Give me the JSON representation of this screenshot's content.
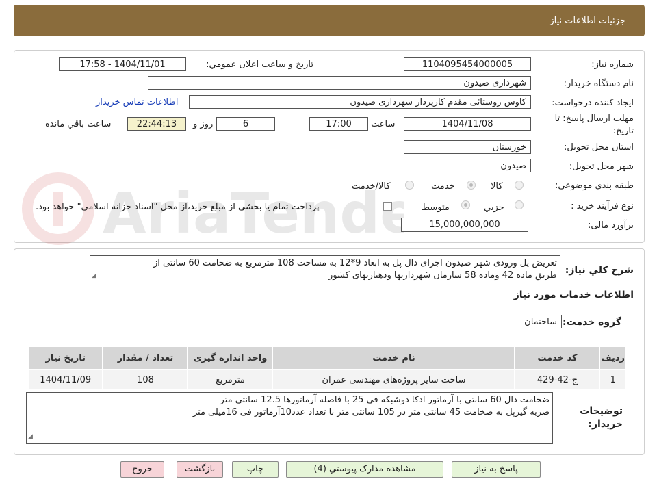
{
  "header": {
    "title": "جزئیات اطلاعات نیاز"
  },
  "form": {
    "need_number_label": "شماره نیاز:",
    "need_number": "1104095454000005",
    "announce_label": "تاریخ و ساعت اعلان عمومي:",
    "announce_value": "1404/11/01 - 17:58",
    "buyer_org_label": "نام دستگاه خريدار:",
    "buyer_org": "شهرداری صیدون",
    "creator_label": "ايجاد کننده درخواست:",
    "creator": "کاوس روستائی مقدم کارپرداز شهرداری صیدون",
    "contact_link": "اطلاعات تماس خريدار",
    "deadline_label": "مهلت ارسال پاسخ: تا",
    "deadline_label2": "تاریخ:",
    "deadline_date": "1404/11/08",
    "time_label": "ساعت",
    "deadline_time": "17:00",
    "days_value": "6",
    "days_label": "روز و",
    "remaining_time": "22:44:13",
    "remaining_label": "ساعت باقي مانده",
    "province_label": "استان محل تحويل:",
    "province": "خوزستان",
    "city_label": "شهر محل تحويل:",
    "city": "صیدون",
    "category_label": "طبقه بندی موضوعی:",
    "category_options": [
      "کالا",
      "خدمت",
      "کالا/خدمت"
    ],
    "category_selected": "خدمت",
    "process_label": "نوع فرآیند خرید :",
    "process_options": [
      "جزیي",
      "متوسط"
    ],
    "process_selected": "متوسط",
    "payment_note": "پرداخت تمام يا بخشی از مبلغ خريد،از محل \"اسناد خزانه اسلامی\" خواهد بود.",
    "budget_label": "برآورد مالی:",
    "budget": "15,000,000,000"
  },
  "description": {
    "label": "شرح کلي نياز:",
    "text_line1": "تعریض پل ورودی شهر صیدون اجرای دال پل به ابعاد 9*12 به مساحت 108 مترمربع به ضخامت 60 سانتی از",
    "text_line2": "طریق ماده 42 وماده 58 سازمان شهرداریها ودهیاریهای کشور"
  },
  "services": {
    "section_title": "اطلاعات خدمات مورد نياز",
    "group_label": "گروه خدمت:",
    "group_value": "ساختمان",
    "table": {
      "headers": [
        "رديف",
        "کد خدمت",
        "نام خدمت",
        "واحد اندازه گيری",
        "تعداد / مقدار",
        "تاريخ نياز"
      ],
      "rows": [
        [
          "1",
          "ج-42-429",
          "ساخت سایر پروژه‌های مهندسی عمران",
          "مترمربع",
          "108",
          "1404/11/09"
        ]
      ]
    }
  },
  "buyer_notes": {
    "label_line1": "توضيحات",
    "label_line2": "خريدار:",
    "line1": "ضخامت دال 60 سانتی با آرماتور ادکا  دوشبکه فی 25 با فاصله آرماتورها  12.5 سانتی متر",
    "line2": "ضربه گیرپل به ضخامت 45 سانتی متر در 105 سانتی متر با تعداد عدد10آرماتور فی 16میلی متر"
  },
  "buttons": {
    "respond": "پاسخ به نياز",
    "attachments": "مشاهده مدارک پيوستي (4)",
    "print": "چاپ",
    "back": "بازگشت",
    "exit": "خروج"
  },
  "watermark": "AriaTender.net"
}
